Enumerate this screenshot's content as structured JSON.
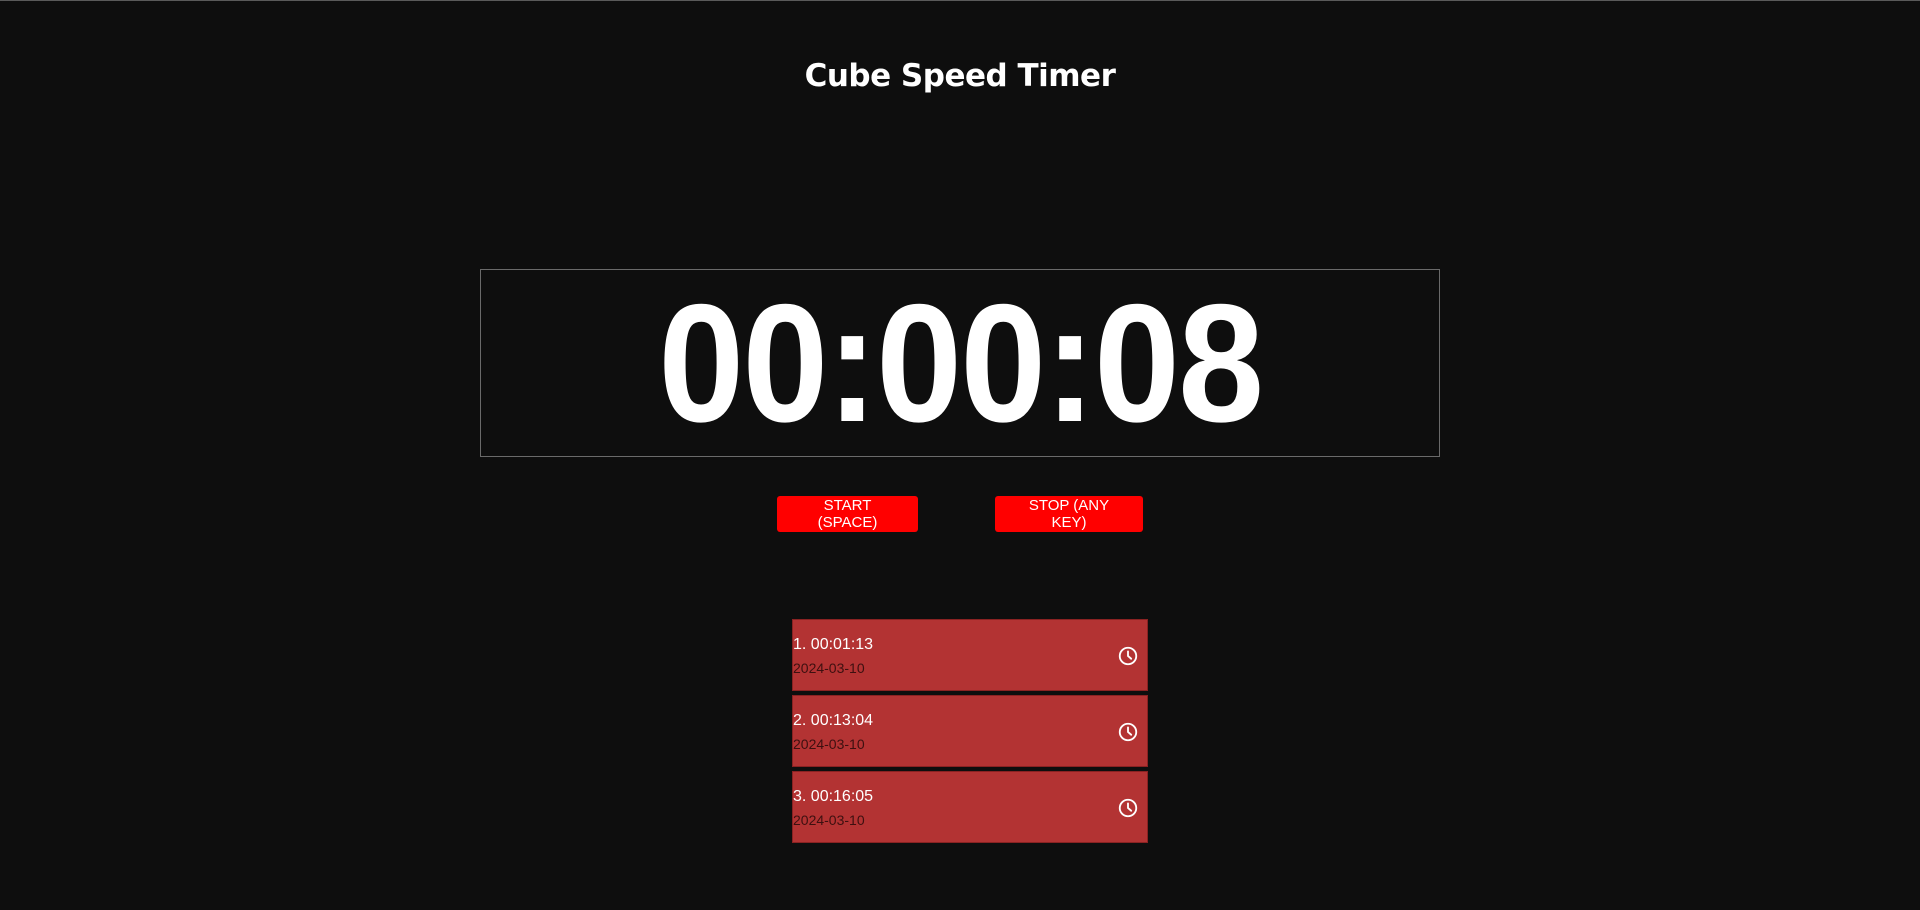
{
  "header": {
    "title": "Cube Speed Timer"
  },
  "timer": {
    "display": "00:00:08"
  },
  "controls": {
    "start_label": "START (SPACE)",
    "stop_label": "STOP (ANY KEY)"
  },
  "history": [
    {
      "label": "1. 00:01:13",
      "date": "2024-03-10",
      "icon": "clock-icon"
    },
    {
      "label": "2. 00:13:04",
      "date": "2024-03-10",
      "icon": "clock-icon"
    },
    {
      "label": "3. 00:16:05",
      "date": "2024-03-10",
      "icon": "clock-icon"
    }
  ],
  "colors": {
    "background": "#0e0e0e",
    "accent": "#ff0000",
    "history_item": "#b33333",
    "date_text": "#3d1010"
  }
}
